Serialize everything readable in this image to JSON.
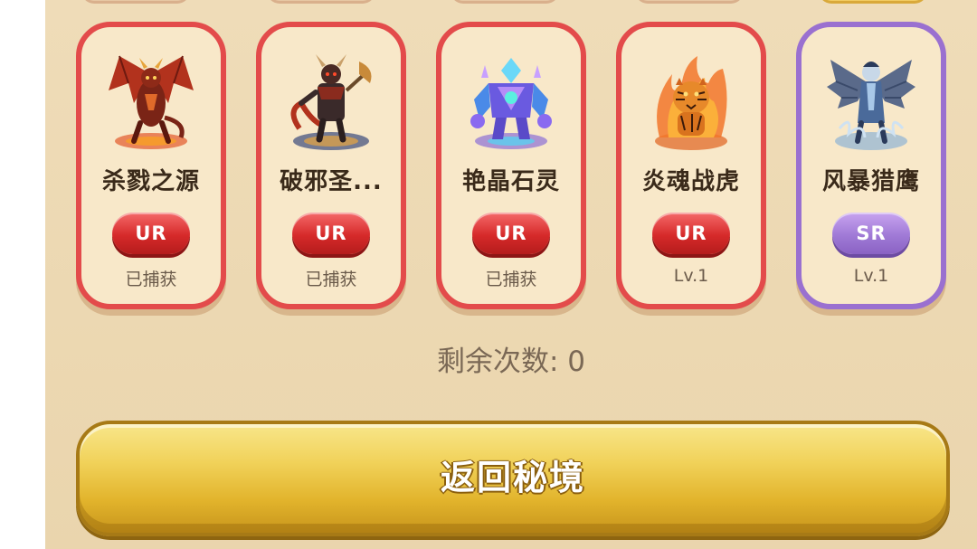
{
  "cards": [
    {
      "name": "杀戮之源",
      "rarity": "UR",
      "status": "已捕获",
      "icon": "red-dragon-demon-icon"
    },
    {
      "name": "破邪圣...",
      "rarity": "UR",
      "status": "已捕获",
      "icon": "armored-demon-axe-icon"
    },
    {
      "name": "艳晶石灵",
      "rarity": "UR",
      "status": "已捕获",
      "icon": "crystal-golem-icon"
    },
    {
      "name": "炎魂战虎",
      "rarity": "UR",
      "status": "Lv.1",
      "icon": "flame-tiger-icon"
    },
    {
      "name": "风暴猎鹰",
      "rarity": "SR",
      "status": "Lv.1",
      "icon": "storm-falcon-warrior-icon"
    }
  ],
  "remaining_label": "剩余次数: 0",
  "return_button_label": "返回秘境",
  "colors": {
    "ur_border": "#e34b4b",
    "sr_border": "#9a70d0",
    "button_gold": "#f1d25a",
    "panel_bg": "#efdcb8"
  }
}
